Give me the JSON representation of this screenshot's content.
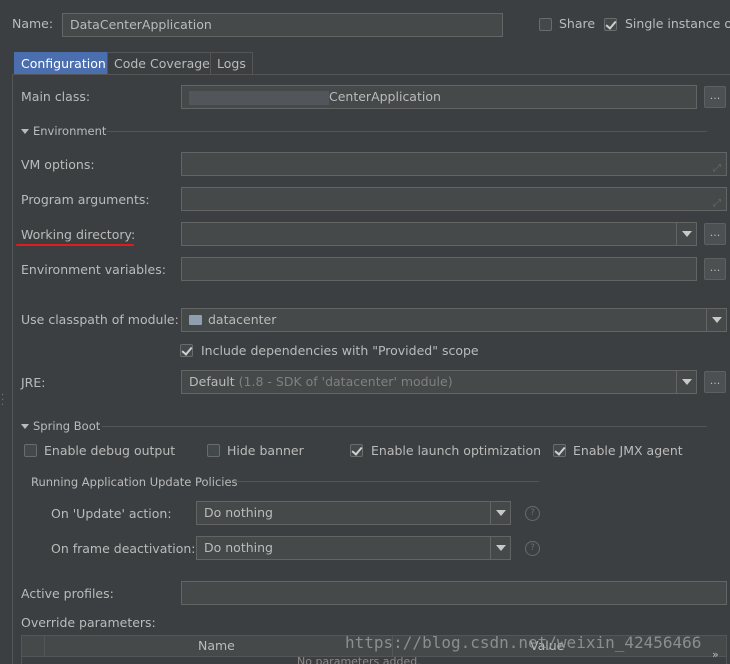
{
  "header": {
    "name_label": "Name:",
    "name_value": "DataCenterApplication",
    "share_label": "Share",
    "share_checked": false,
    "single_instance_label": "Single instance on",
    "single_instance_checked": true
  },
  "tabs": [
    {
      "label": "Configuration",
      "active": true
    },
    {
      "label": "Code Coverage",
      "active": false
    },
    {
      "label": "Logs",
      "active": false
    }
  ],
  "main_class": {
    "label": "Main class:",
    "value": "CenterApplication",
    "browse": "..."
  },
  "environment": {
    "title": "Environment",
    "vm_options_label": "VM options:",
    "program_args_label": "Program arguments:",
    "working_dir_label": "Working directory:",
    "env_vars_label": "Environment variables:",
    "classpath_label": "Use classpath of module:",
    "classpath_value": "datacenter",
    "include_deps_label": "Include dependencies with \"Provided\" scope",
    "jre_label": "JRE:",
    "jre_value": "Default",
    "jre_detail": "(1.8 - SDK of 'datacenter' module)"
  },
  "spring_boot": {
    "title": "Spring Boot",
    "debug_output": "Enable debug output",
    "hide_banner": "Hide banner",
    "launch_opt": "Enable launch optimization",
    "jmx_agent": "Enable JMX agent",
    "policies_title": "Running Application Update Policies",
    "on_update_label": "On 'Update' action:",
    "on_update_value": "Do nothing",
    "on_frame_label": "On frame deactivation:",
    "on_frame_value": "Do nothing"
  },
  "profiles": {
    "active_label": "Active profiles:",
    "override_label": "Override parameters:",
    "col_name": "Name",
    "col_value": "Value",
    "empty_text": "No parameters added."
  },
  "watermark": "https://blog.csdn.net/weixin_42456466"
}
